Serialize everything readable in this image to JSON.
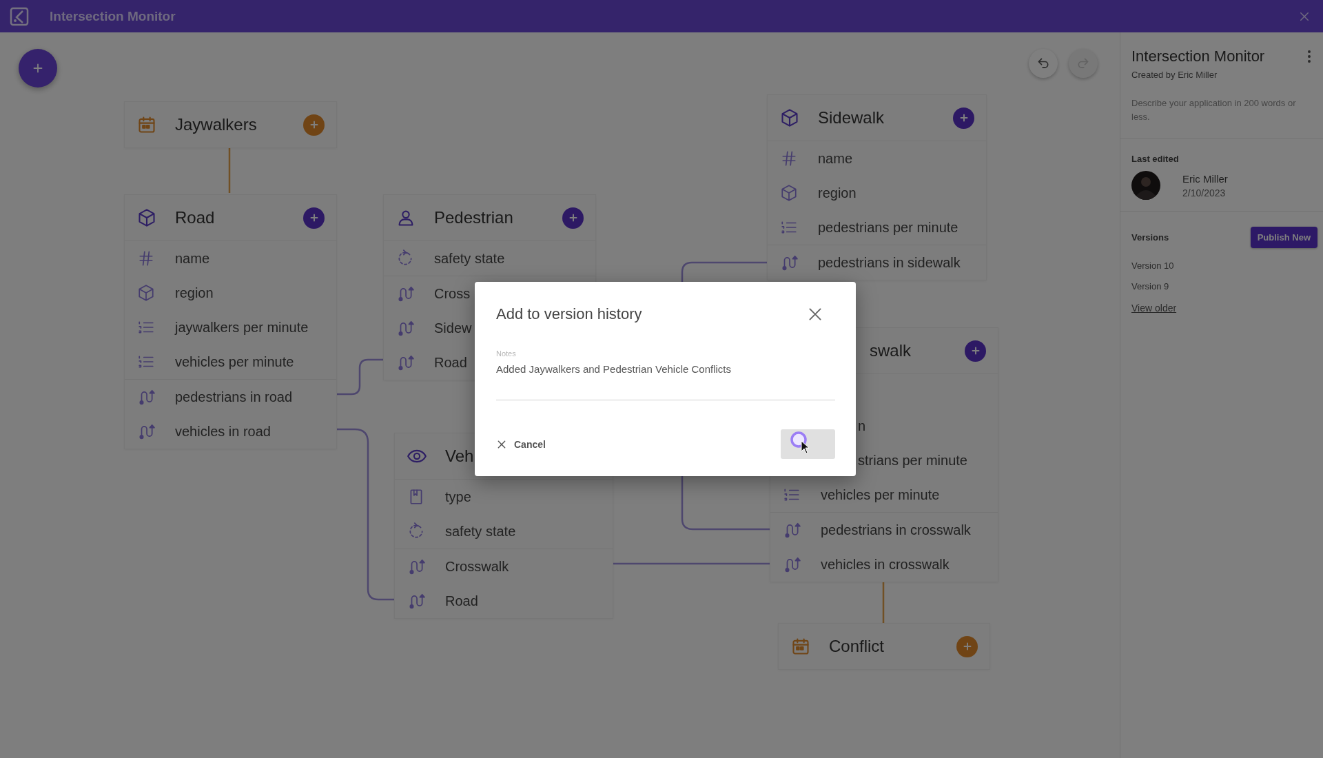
{
  "app_bar": {
    "title": "Intersection Monitor"
  },
  "canvas": {
    "history": [
      {
        "kind": "undo",
        "disabled": false
      },
      {
        "kind": "redo",
        "disabled": true
      }
    ],
    "nodes": [
      {
        "kind": "event",
        "title": "Jaywalkers",
        "covered": false
      },
      {
        "kind": "place",
        "title": "Road",
        "covered": false,
        "rows": [
          {
            "kind": "id",
            "label": "name",
            "covered": false
          },
          {
            "kind": "place",
            "label": "region",
            "covered": false
          },
          {
            "kind": "count",
            "label": "jaywalkers per minute",
            "covered": false
          },
          {
            "kind": "count",
            "label": "vehicles per minute",
            "covered": false
          },
          {
            "kind": "relation",
            "label": "pedestrians in road",
            "covered": false
          },
          {
            "kind": "relation",
            "label": "vehicles in road",
            "covered": false
          }
        ]
      },
      {
        "kind": "person",
        "title": "Pedestrian",
        "covered": false,
        "rows": [
          {
            "kind": "status",
            "label": "safety state",
            "covered": false
          },
          {
            "kind": "relation",
            "label": "Cross",
            "covered": false
          },
          {
            "kind": "relation",
            "label": "Sidew",
            "covered": false
          },
          {
            "kind": "relation",
            "label": "Road",
            "covered": false
          }
        ]
      },
      {
        "kind": "watched",
        "title": "Veh",
        "covered": false,
        "rows": [
          {
            "kind": "category",
            "label": "type",
            "covered": false
          },
          {
            "kind": "status",
            "label": "safety state",
            "covered": false
          },
          {
            "kind": "relation",
            "label": "Crosswalk",
            "covered": false
          },
          {
            "kind": "relation",
            "label": "Road",
            "covered": false
          }
        ]
      },
      {
        "kind": "place",
        "title": "Sidewalk",
        "covered": false,
        "rows": [
          {
            "kind": "id",
            "label": "name",
            "covered": false
          },
          {
            "kind": "place",
            "label": "region",
            "covered": false
          },
          {
            "kind": "count",
            "label": "pedestrians per minute",
            "covered": false
          },
          {
            "kind": "relation",
            "label": "pedestrians in sidewalk",
            "covered": false
          }
        ]
      },
      {
        "kind": "place",
        "title": "swalk",
        "covered": true,
        "rows": [
          {
            "kind": "place",
            "label": "n",
            "covered": true
          },
          {
            "kind": "count",
            "label": "strians per minute",
            "covered": true
          },
          {
            "kind": "count",
            "label": "vehicles per minute",
            "covered": false
          },
          {
            "kind": "relation",
            "label": "pedestrians in crosswalk",
            "covered": false
          },
          {
            "kind": "relation",
            "label": "vehicles in crosswalk",
            "covered": false
          }
        ]
      },
      {
        "kind": "event",
        "title": "Conflict",
        "covered": false
      }
    ]
  },
  "details": {
    "title": "Intersection Monitor",
    "created_by": "Created by Eric Miller",
    "description": {
      "placeholder": "Describe your application in 200 words or less."
    },
    "last_edited": {
      "label": "Last edited",
      "name": "Eric Miller",
      "date": "2/10/2023"
    },
    "versions": {
      "label": "Versions",
      "button": "Publish New",
      "items": [
        "Version 10",
        "Version 9"
      ],
      "more": "View older"
    }
  },
  "dialog": {
    "title": "Add to version history",
    "notes": {
      "label": "Notes",
      "value": "Added Jaywalkers and Pedestrian Vehicle Conflicts"
    },
    "cancel": "Cancel",
    "submit": {
      "loading": true
    }
  }
}
